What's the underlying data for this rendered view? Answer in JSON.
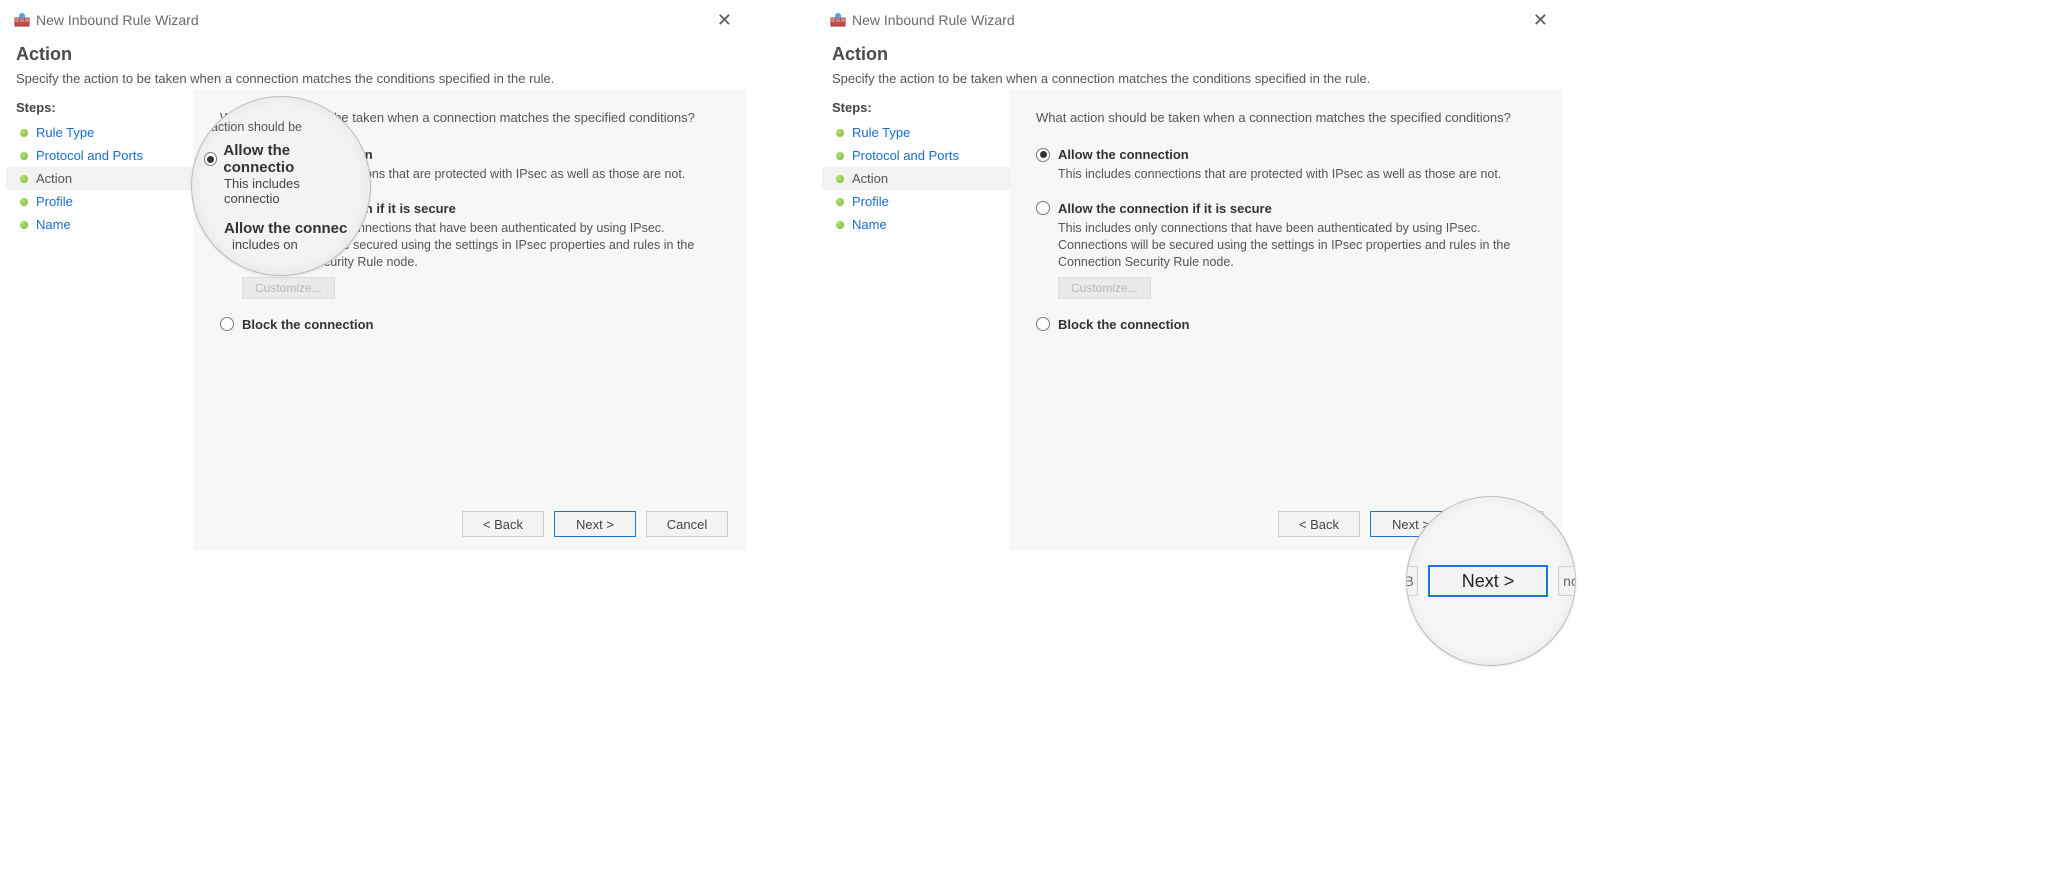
{
  "dialog": {
    "title": "New Inbound Rule Wizard",
    "close_glyph": "✕",
    "header_title": "Action",
    "header_sub": "Specify the action to be taken when a connection matches the conditions specified in the rule."
  },
  "steps": {
    "heading": "Steps:",
    "items": [
      {
        "label": "Rule Type",
        "current": false
      },
      {
        "label": "Protocol and Ports",
        "current": false
      },
      {
        "label": "Action",
        "current": true
      },
      {
        "label": "Profile",
        "current": false
      },
      {
        "label": "Name",
        "current": false
      }
    ]
  },
  "main": {
    "prompt": "What action should be taken when a connection matches the specified conditions?",
    "options": [
      {
        "id": "allow",
        "label": "Allow the connection",
        "desc": "This includes connections that are protected with IPsec as well as those are not.",
        "selected": true
      },
      {
        "id": "allow-secure",
        "label": "Allow the connection if it is secure",
        "desc": "This includes only connections that have been authenticated by using IPsec.  Connections will be secured using the settings in IPsec properties and rules in the Connection Security Rule node.",
        "selected": false,
        "customize_label": "Customize..."
      },
      {
        "id": "block",
        "label": "Block the connection",
        "desc": "",
        "selected": false
      }
    ]
  },
  "footer": {
    "back": "< Back",
    "next": "Next >",
    "cancel": "Cancel"
  },
  "lens_left": {
    "line1": "t action should be",
    "opt1": "Allow the connectio",
    "opt1_sub": "This includes connectio",
    "opt2": "Allow the connec",
    "opt2_sub": "includes on"
  },
  "lens_right": {
    "back_fragment": "< B",
    "next": "Next >",
    "cancel_fragment": "ncel"
  }
}
